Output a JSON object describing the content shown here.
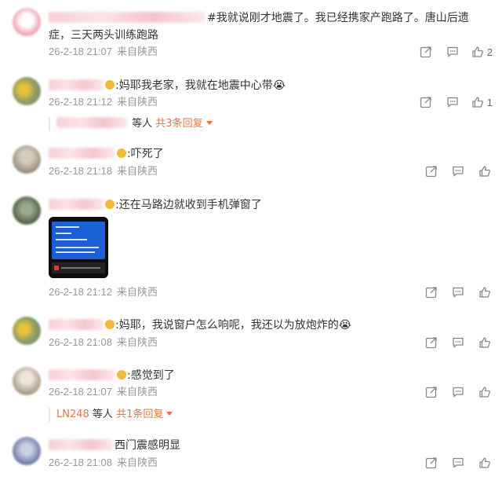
{
  "comments": [
    {
      "text": "#我就说刚才地震了。我已经携家产跑路了。唐山后遗症，三天两头训练跑路",
      "date": "26-2-18 21:07",
      "source": "来自陕西",
      "likes": "2"
    },
    {
      "text": ":妈耶我老家，我就在地震中心带😭",
      "date": "26-2-18 21:12",
      "source": "来自陕西",
      "likes": "1",
      "replies": {
        "suffix": "等人",
        "link": "共3条回复"
      }
    },
    {
      "text": ":吓死了",
      "date": "26-2-18 21:18",
      "source": "来自陕西"
    },
    {
      "text": ":还在马路边就收到手机弹窗了",
      "date": "26-2-18 21:12",
      "source": "来自陕西"
    },
    {
      "text": ":妈耶，我说窗户怎么响呢，我还以为放炮炸的😭",
      "date": "26-2-18 21:08",
      "source": "来自陕西"
    },
    {
      "text": ":感觉到了",
      "date": "26-2-18 21:07",
      "source": "来自陕西",
      "replies": {
        "user": "LN248",
        "suffix": "等人",
        "link": "共1条回复"
      }
    },
    {
      "text": "西门震感明显",
      "date": "26-2-18 21:08",
      "source": "来自陕西"
    }
  ],
  "colors": {
    "meta": "#999999",
    "reply_link": "#eb7340",
    "reply_user": "#eb7340"
  }
}
